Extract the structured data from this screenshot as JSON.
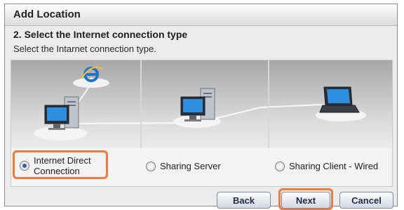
{
  "dialog": {
    "title": "Add Location",
    "step_heading": "2. Select the Internet connection type",
    "instruction": "Select the Intarnet connection type."
  },
  "options": [
    {
      "label_line1": "Internet Direct",
      "label_line2": "Connection",
      "selected": true
    },
    {
      "label": "Sharing Server",
      "selected": false
    },
    {
      "label": "Sharing Client - Wired",
      "selected": false
    }
  ],
  "buttons": {
    "back": "Back",
    "next": "Next",
    "cancel": "Cancel"
  },
  "colors": {
    "highlight": "#ef7a3c",
    "radio_selected": "#2f5fb0",
    "panel_gradient_top": "#a7a7a7"
  },
  "icons": [
    "internet-explorer-icon",
    "desktop-computer-icon",
    "server-computer-icon",
    "laptop-icon"
  ]
}
